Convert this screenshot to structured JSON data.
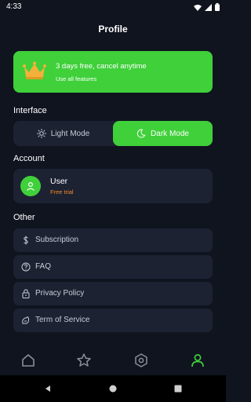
{
  "status_bar": {
    "time": "4:33"
  },
  "header": {
    "title": "Profile"
  },
  "promo": {
    "title": "3 days free, cancel anytime",
    "subtitle": "Use all features",
    "icon": "crown-icon",
    "color": "#3fd03a"
  },
  "interface": {
    "label": "Interface",
    "light_label": "Light Mode",
    "dark_label": "Dark Mode",
    "selected": "Dark Mode"
  },
  "account": {
    "label": "Account",
    "user_name": "User",
    "plan": "Free trial",
    "plan_color": "#f08a24"
  },
  "other": {
    "label": "Other",
    "items": [
      {
        "label": "Subscription",
        "icon": "dollar-icon"
      },
      {
        "label": "FAQ",
        "icon": "question-icon"
      },
      {
        "label": "Privacy Policy",
        "icon": "lock-icon"
      },
      {
        "label": "Term of Service",
        "icon": "terms-icon"
      }
    ]
  },
  "bottom_nav": {
    "items": [
      {
        "icon": "home-icon",
        "active": false
      },
      {
        "icon": "star-icon",
        "active": false
      },
      {
        "icon": "hexagon-icon",
        "active": false
      },
      {
        "icon": "profile-icon",
        "active": true
      }
    ]
  },
  "colors": {
    "background": "#10141f",
    "card": "#1d2233",
    "accent": "#3fd03a"
  }
}
